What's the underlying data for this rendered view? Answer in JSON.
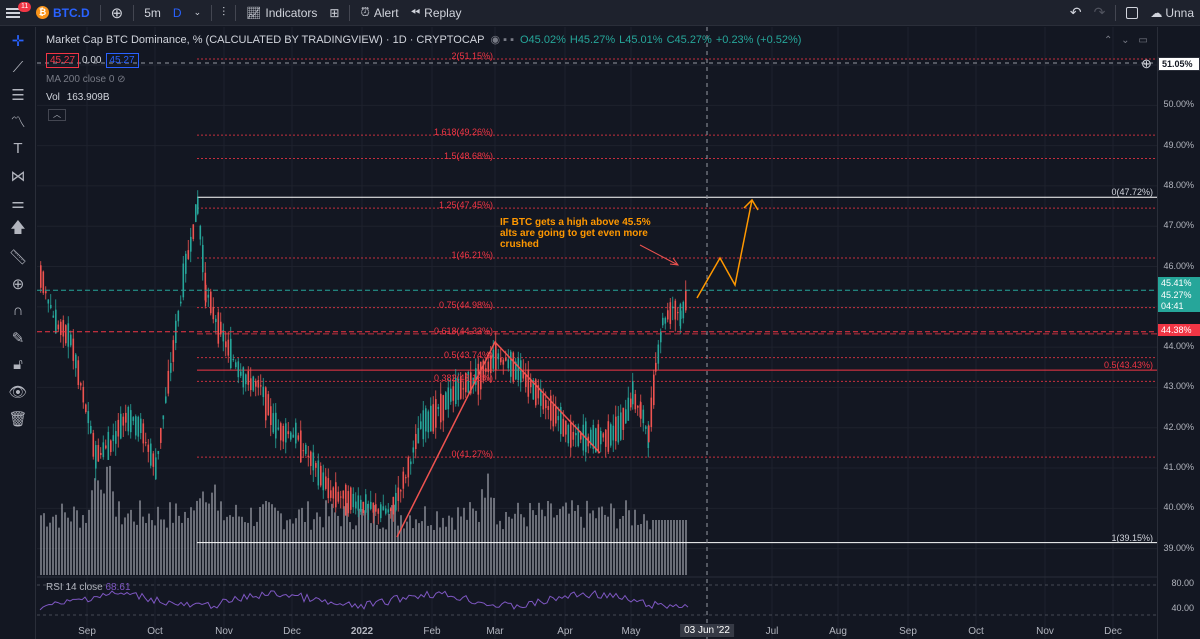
{
  "topbar": {
    "notif_count": "11",
    "symbol": "BTC.D",
    "interval": "5m",
    "interval_d": "D",
    "indicators": "Indicators",
    "alert": "Alert",
    "replay": "Replay",
    "right_text": "Unna"
  },
  "legend": {
    "title": "Market Cap BTC Dominance, % (CALCULATED BY TRADINGVIEW) · 1D · CRYPTOCAP",
    "open": "O45.02%",
    "high": "H45.27%",
    "low": "L45.01%",
    "close": "C45.27%",
    "change": "+0.23% (+0.52%)",
    "bid": "45.27",
    "spread": "0.00",
    "ask": "45.27",
    "ma": "MA 200 close 0",
    "vol_label": "Vol",
    "vol_value": "163.909B"
  },
  "rsi": {
    "label": "RSI 14 close",
    "value": "68.61"
  },
  "annotation": {
    "line1": "IF BTC gets a high above 45.5%",
    "line2": "alts are going to get even more",
    "line3": "crushed"
  },
  "price_axis": [
    "51.05%",
    "50.00%",
    "49.00%",
    "48.00%",
    "47.00%",
    "46.00%",
    "45.00%",
    "44.00%",
    "43.00%",
    "42.00%",
    "41.00%",
    "40.00%",
    "39.00%"
  ],
  "rsi_axis": [
    "80.00",
    "40.00"
  ],
  "price_tags": {
    "crosshair": "51.05%",
    "current_1": "45.41%",
    "current_2": "45.27%",
    "countdown": "04:41",
    "red": "44.38%"
  },
  "fib_left": [
    {
      "label": "2(51.15%)"
    },
    {
      "label": "1.618(49.26%)"
    },
    {
      "label": "1.5(48.68%)"
    },
    {
      "label": "1.25(47.45%)"
    },
    {
      "label": "1(46.21%)"
    },
    {
      "label": "0.75(44.98%)"
    },
    {
      "label": "0.618(44.33%)"
    },
    {
      "label": "0.5(43.74%)"
    },
    {
      "label": "0.382(43.15%)"
    },
    {
      "label": "0(41.27%)"
    }
  ],
  "fib_right": [
    {
      "label": "0(47.72%)"
    },
    {
      "label": "0.5(43.43%)"
    },
    {
      "label": "1(39.15%)"
    }
  ],
  "dates": [
    "Sep",
    "Oct",
    "Nov",
    "Dec",
    "2022",
    "Feb",
    "Mar",
    "Apr",
    "May",
    "Jul",
    "Aug",
    "Sep",
    "Oct",
    "Nov",
    "Dec"
  ],
  "current_date": "03 Jun '22",
  "colors": {
    "up": "#26a69a",
    "down": "#ef5350",
    "fib": "#f23645",
    "accent": "#2962ff",
    "annotation": "#ff9800",
    "rsi": "#7e57c2"
  }
}
